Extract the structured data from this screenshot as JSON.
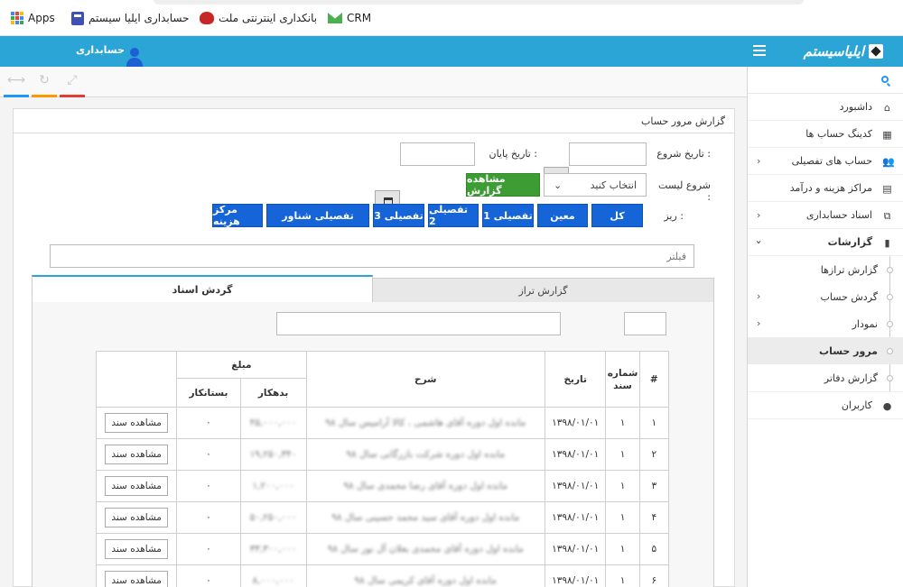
{
  "bookmarks": [
    {
      "label": "Apps",
      "icon": "apps-grid-icon"
    },
    {
      "label": "حسابداری ایلیا سیستم",
      "icon": "calculator-icon"
    },
    {
      "label": "بانکداری اینترنتی ملت",
      "icon": "bank-icon"
    },
    {
      "label": "CRM",
      "icon": "mail-icon"
    }
  ],
  "header": {
    "brand": "ایلیاسیستم",
    "user_label": "حسابداری"
  },
  "toolbar": {
    "tools": [
      {
        "icon": "resize-icon",
        "color": "#2196f3"
      },
      {
        "icon": "refresh-icon",
        "color": "#ff9800"
      },
      {
        "icon": "fullscreen-icon",
        "color": "#e53935"
      }
    ]
  },
  "sidebar": {
    "items": [
      {
        "label": "داشبورد",
        "icon": "home-icon",
        "has_children": false
      },
      {
        "label": "کدینگ حساب ها",
        "icon": "grid-icon",
        "has_children": false
      },
      {
        "label": "حساب های تفصیلی",
        "icon": "users-icon",
        "has_children": true
      },
      {
        "label": "مراکز هزینه و درآمد",
        "icon": "building-icon",
        "has_children": false
      },
      {
        "label": "اسناد حسابداری",
        "icon": "copy-icon",
        "has_children": true
      },
      {
        "label": "گزارشات",
        "icon": "book-icon",
        "has_children": true,
        "open": true
      }
    ],
    "sub_items": [
      {
        "label": "گزارش ترازها",
        "has_children": false
      },
      {
        "label": "گردش حساب",
        "has_children": true
      },
      {
        "label": "نمودار",
        "has_children": true
      },
      {
        "label": "مرور حساب",
        "has_children": false,
        "active": true
      },
      {
        "label": "گزارش دفاتر",
        "has_children": false
      }
    ],
    "bottom_item": {
      "label": "کاربران",
      "icon": "user-icon"
    }
  },
  "panel": {
    "title": "گزارش مرور حساب",
    "start_date_label": "تاریخ شروع :",
    "end_date_label": "تاریخ پایان :",
    "list_start_label": "شروع لیست :",
    "select_placeholder": "انتخاب کنید",
    "view_report_button": "مشاهده گزارش",
    "detail_label": "ریز :",
    "detail_buttons": [
      "کل",
      "معین",
      "تفصیلی 1",
      "تفصیلی 2",
      "تفصیلی 3",
      "تفصیلی شناور",
      "مرکز هزینه"
    ],
    "filter_placeholder": "فیلتر",
    "tabs": [
      {
        "label": "گزارش تراز",
        "active": false
      },
      {
        "label": "گردش اسناد",
        "active": true
      }
    ]
  },
  "table": {
    "headers": {
      "index": "#",
      "doc_no": "شماره سند",
      "date": "تاریخ",
      "desc": "شرح",
      "amount": "مبلغ",
      "debit": "بدهکار",
      "credit": "بستانکار"
    },
    "view_doc_label": "مشاهده سند",
    "rows": [
      {
        "index": "۱",
        "doc_no": "۱",
        "date": "۱۳۹۸/۰۱/۰۱",
        "desc": "مانده اول دوره آقای هاشمی ، کالا آرامیس سال ۹۸",
        "debit": "۴۵,۰۰۰,۰۰۰",
        "credit": "۰"
      },
      {
        "index": "۲",
        "doc_no": "۱",
        "date": "۱۳۹۸/۰۱/۰۱",
        "desc": "مانده اول دوره شرکت بازرگانی سال ۹۸",
        "debit": "۱۹,۲۵۰,۳۴۰",
        "credit": "۰"
      },
      {
        "index": "۳",
        "doc_no": "۱",
        "date": "۱۳۹۸/۰۱/۰۱",
        "desc": "مانده اول دوره آقای رضا محمدی سال ۹۸",
        "debit": "۱,۲۰۰,۰۰۰",
        "credit": "۰"
      },
      {
        "index": "۴",
        "doc_no": "۱",
        "date": "۱۳۹۸/۰۱/۰۱",
        "desc": "مانده اول دوره آقای سید محمد حسینی سال ۹۸",
        "debit": "۵۰,۲۵۰,۰۰۰",
        "credit": "۰"
      },
      {
        "index": "۵",
        "doc_no": "۱",
        "date": "۱۳۹۸/۰۱/۰۱",
        "desc": "مانده اول دوره آقای محمدی بغلان آل نور سال ۹۸",
        "debit": "۳۳,۳۰۰,۰۰۰",
        "credit": "۰"
      },
      {
        "index": "۶",
        "doc_no": "۱",
        "date": "۱۳۹۸/۰۱/۰۱",
        "desc": "مانده اول دوره آقای کریمی سال ۹۸",
        "debit": "۸,۰۰۰,۰۰۰",
        "credit": "۰"
      }
    ]
  }
}
